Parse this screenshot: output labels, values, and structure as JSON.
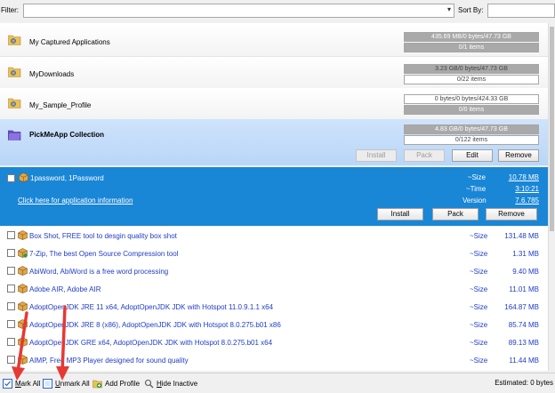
{
  "filter": {
    "label": "Filter:",
    "value": ""
  },
  "sort": {
    "label": "Sort By:",
    "value": ""
  },
  "profiles": [
    {
      "name": "My Captured Applications",
      "size_text": "435.69 MB/0 bytes/47.73 GB",
      "size_fill": 1.0,
      "items_text": "0/1 items",
      "items_fill": 1.0
    },
    {
      "name": "MyDownloads",
      "size_text": "3.23 GB/0 bytes/47.73 GB",
      "size_fill": 1.0,
      "items_text": "0/22 items",
      "items_fill": 0.0
    },
    {
      "name": "My_Sample_Profile",
      "size_text": "0 bytes/0 bytes/424.33 GB",
      "size_fill": 0.0,
      "items_text": "0/0 items",
      "items_fill": 1.0
    }
  ],
  "collection": {
    "name": "PickMeApp Collection",
    "size_text": "4.83 GB/0 bytes/47.73 GB",
    "size_fill": 1.0,
    "items_text": "0/122 items",
    "items_fill": 0.0,
    "buttons": {
      "install": "Install",
      "pack": "Pack",
      "edit": "Edit",
      "remove": "Remove"
    }
  },
  "expanded_item": {
    "name": "1password, 1Password",
    "info_link": "Click here for application information",
    "size_key": "~Size",
    "size_val": "10.78 MB",
    "time_key": "~Time",
    "time_val": "3:10:21",
    "version_key": "Version",
    "version_val": "7.6.785",
    "buttons": {
      "install": "Install",
      "pack": "Pack",
      "remove": "Remove"
    }
  },
  "items": [
    {
      "name": "Box Shot, FREE tool to desgin quality box shot",
      "size_key": "~Size",
      "size": "131.48 MB"
    },
    {
      "name": "7-Zip, The best Open Source Compression tool",
      "size_key": "~Size",
      "size": "1.31 MB"
    },
    {
      "name": "AbiWord, AbiWord is a free word processing",
      "size_key": "~Size",
      "size": "9.40 MB"
    },
    {
      "name": "Adobe AIR, Adobe AIR",
      "size_key": "~Size",
      "size": "11.01 MB"
    },
    {
      "name": "AdoptOpenJDK JRE 11 x64, AdoptOpenJDK JDK with Hotspot 11.0.9.1.1 x64",
      "size_key": "~Size",
      "size": "164.87 MB"
    },
    {
      "name": "AdoptOpenJDK JRE 8 (x86), AdoptOpenJDK JDK with Hotspot 8.0.275.b01 x86",
      "size_key": "~Size",
      "size": "85.74 MB"
    },
    {
      "name": "AdoptOpenJDK GRE x64, AdoptOpenJDK JDK with Hotspot 8.0.275.b01 x64",
      "size_key": "~Size",
      "size": "89.13 MB"
    },
    {
      "name": "AIMP, Free MP3 Player designed for sound quality",
      "size_key": "~Size",
      "size": "11.44 MB"
    }
  ],
  "toolbar": {
    "mark_all_a": "M",
    "mark_all_b": "ark All",
    "unmark_all_a": "U",
    "unmark_all_b": "nmark All",
    "add_profile": "Add Profile",
    "hide_inactive_a": "H",
    "hide_inactive_b": "ide Inactive",
    "estimated": "Estimated: 0 bytes"
  },
  "colors": {
    "selection": "#1a86d6",
    "link": "#1f3cc7",
    "annotation": "#e53935"
  },
  "icons": {
    "profile": "folder-gear-icon",
    "collection": "folder-purple-icon",
    "item": "package-icon"
  }
}
